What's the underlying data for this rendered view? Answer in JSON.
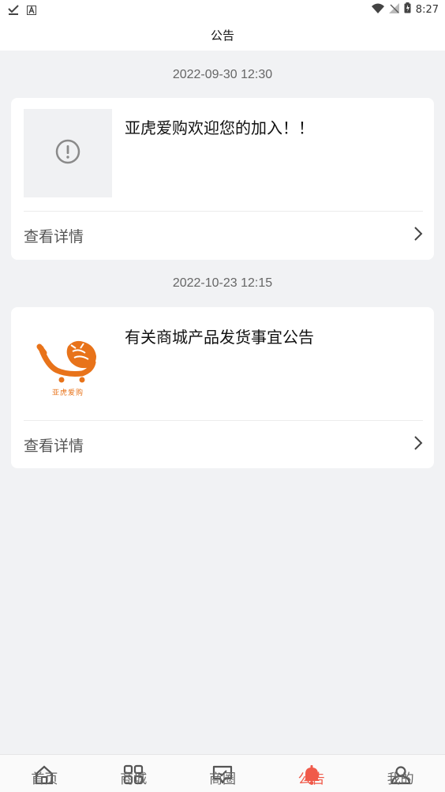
{
  "status_bar": {
    "time": "8:27"
  },
  "header": {
    "title": "公告"
  },
  "notices": [
    {
      "date": "2022-09-30 12:30",
      "title": "亚虎爱购欢迎您的加入！！",
      "detail_label": "查看详情"
    },
    {
      "date": "2022-10-23 12:15",
      "title": "有关商城产品发货事宜公告",
      "detail_label": "查看详情",
      "logo_text": "亚虎爱购"
    }
  ],
  "tabbar": {
    "items": [
      {
        "label": "首页",
        "icon": "home-icon"
      },
      {
        "label": "商城",
        "icon": "grid-icon"
      },
      {
        "label": "商圈",
        "icon": "chat-icon"
      },
      {
        "label": "公告",
        "icon": "bell-icon",
        "active": true
      },
      {
        "label": "我的",
        "icon": "user-icon"
      }
    ],
    "active_color": "#f05a4a"
  }
}
